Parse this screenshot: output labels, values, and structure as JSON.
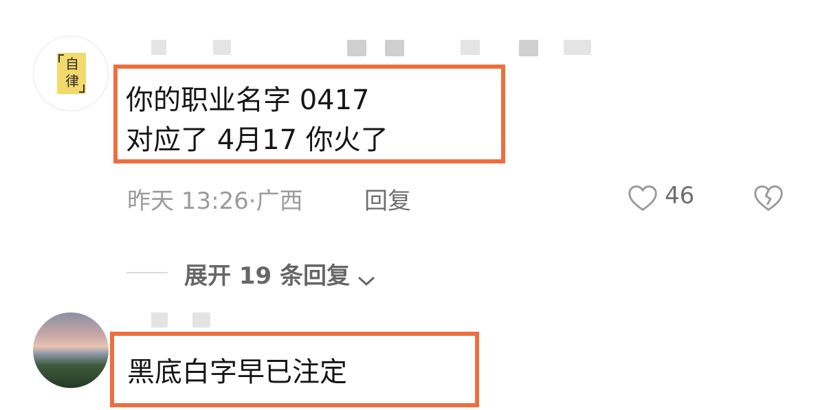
{
  "comments": [
    {
      "avatar_text": [
        "自",
        "律"
      ],
      "text_lines": [
        "你的职业名字 0417",
        "对应了 4月17 你火了"
      ],
      "time": "昨天 13:26",
      "location": "广西",
      "reply_label": "回复",
      "like_count": "46"
    },
    {
      "text_lines": [
        "黑底白字早已注定"
      ]
    }
  ],
  "expand_replies": "展开 19 条回复",
  "colors": {
    "highlight": "#ef6e3d"
  }
}
